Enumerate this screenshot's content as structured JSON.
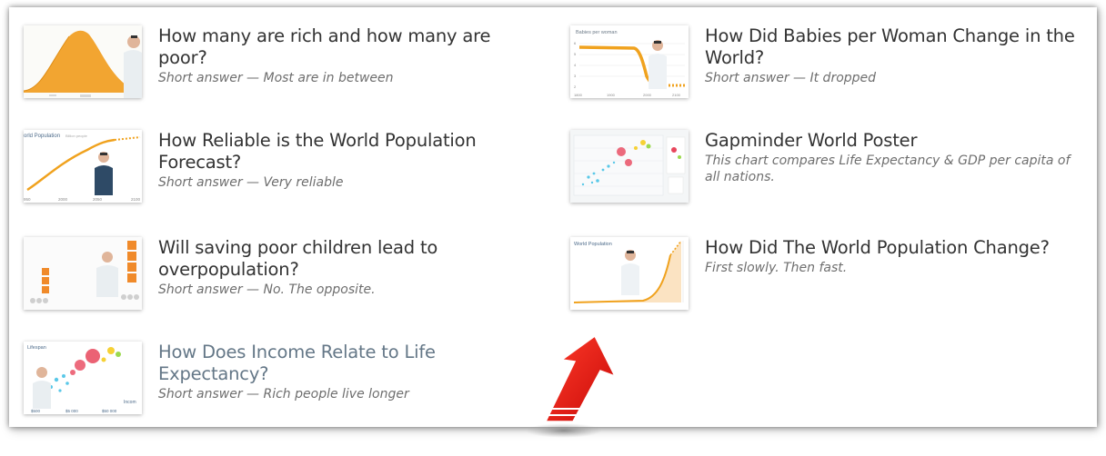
{
  "articles": [
    {
      "title": "How many are rich and how many are poor?",
      "subtitle": "Short answer — Most are in between",
      "thumb_icon": "income-mountain-thumbnail"
    },
    {
      "title": "How Did Babies per Woman Change in the World?",
      "subtitle": "Short answer — It dropped",
      "thumb_icon": "babies-per-woman-chart-thumbnail",
      "thumb_label": "Babies per woman",
      "thumb_ticks": [
        "1800",
        "1900",
        "2000",
        "2100"
      ]
    },
    {
      "title": "How Reliable is the World Population Forecast?",
      "subtitle": "Short answer — Very reliable",
      "thumb_icon": "population-forecast-chart-thumbnail",
      "thumb_label": "orld Population",
      "thumb_label_small": "Billion people",
      "thumb_ticks": [
        "950",
        "2000",
        "2050",
        "2100"
      ]
    },
    {
      "title": "Gapminder World Poster",
      "subtitle": "This chart compares Life Expectancy & GDP per capita of all nations.",
      "thumb_icon": "bubble-poster-thumbnail"
    },
    {
      "title": "Will saving poor children lead to overpopulation?",
      "subtitle": "Short answer — No. The opposite.",
      "thumb_icon": "presenter-boxes-thumbnail"
    },
    {
      "title": "How Did The World Population Change?",
      "subtitle": "First slowly. Then fast.",
      "thumb_icon": "world-population-chart-thumbnail",
      "thumb_label": "World Population"
    },
    {
      "title": "How Does Income Relate to Life Expectancy?",
      "subtitle": "Short answer — Rich people live longer",
      "thumb_icon": "lifespan-bubble-chart-thumbnail",
      "thumb_label": "Lifespan",
      "thumb_label_x": "Incom",
      "thumb_ticks": [
        "$500",
        "$5 000",
        "$50 000"
      ]
    }
  ],
  "overlay": {
    "arrow_icon": "red-arrow-icon",
    "arrow_color": "#e8100c"
  }
}
